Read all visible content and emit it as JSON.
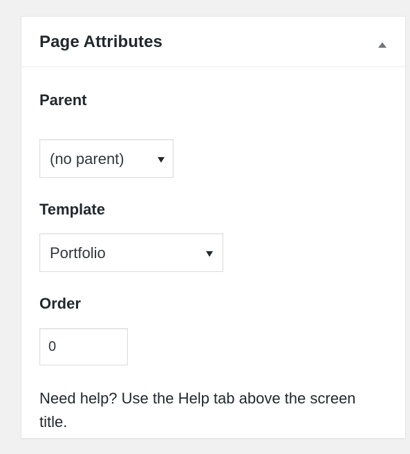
{
  "page_attributes": {
    "title": "Page Attributes",
    "toggle_icon": "triangle-up-icon",
    "parent": {
      "label": "Parent",
      "selected": "(no parent)"
    },
    "template": {
      "label": "Template",
      "selected": "Portfolio"
    },
    "order": {
      "label": "Order",
      "value": "0"
    },
    "help_text": "Need help? Use the Help tab above the screen title."
  }
}
